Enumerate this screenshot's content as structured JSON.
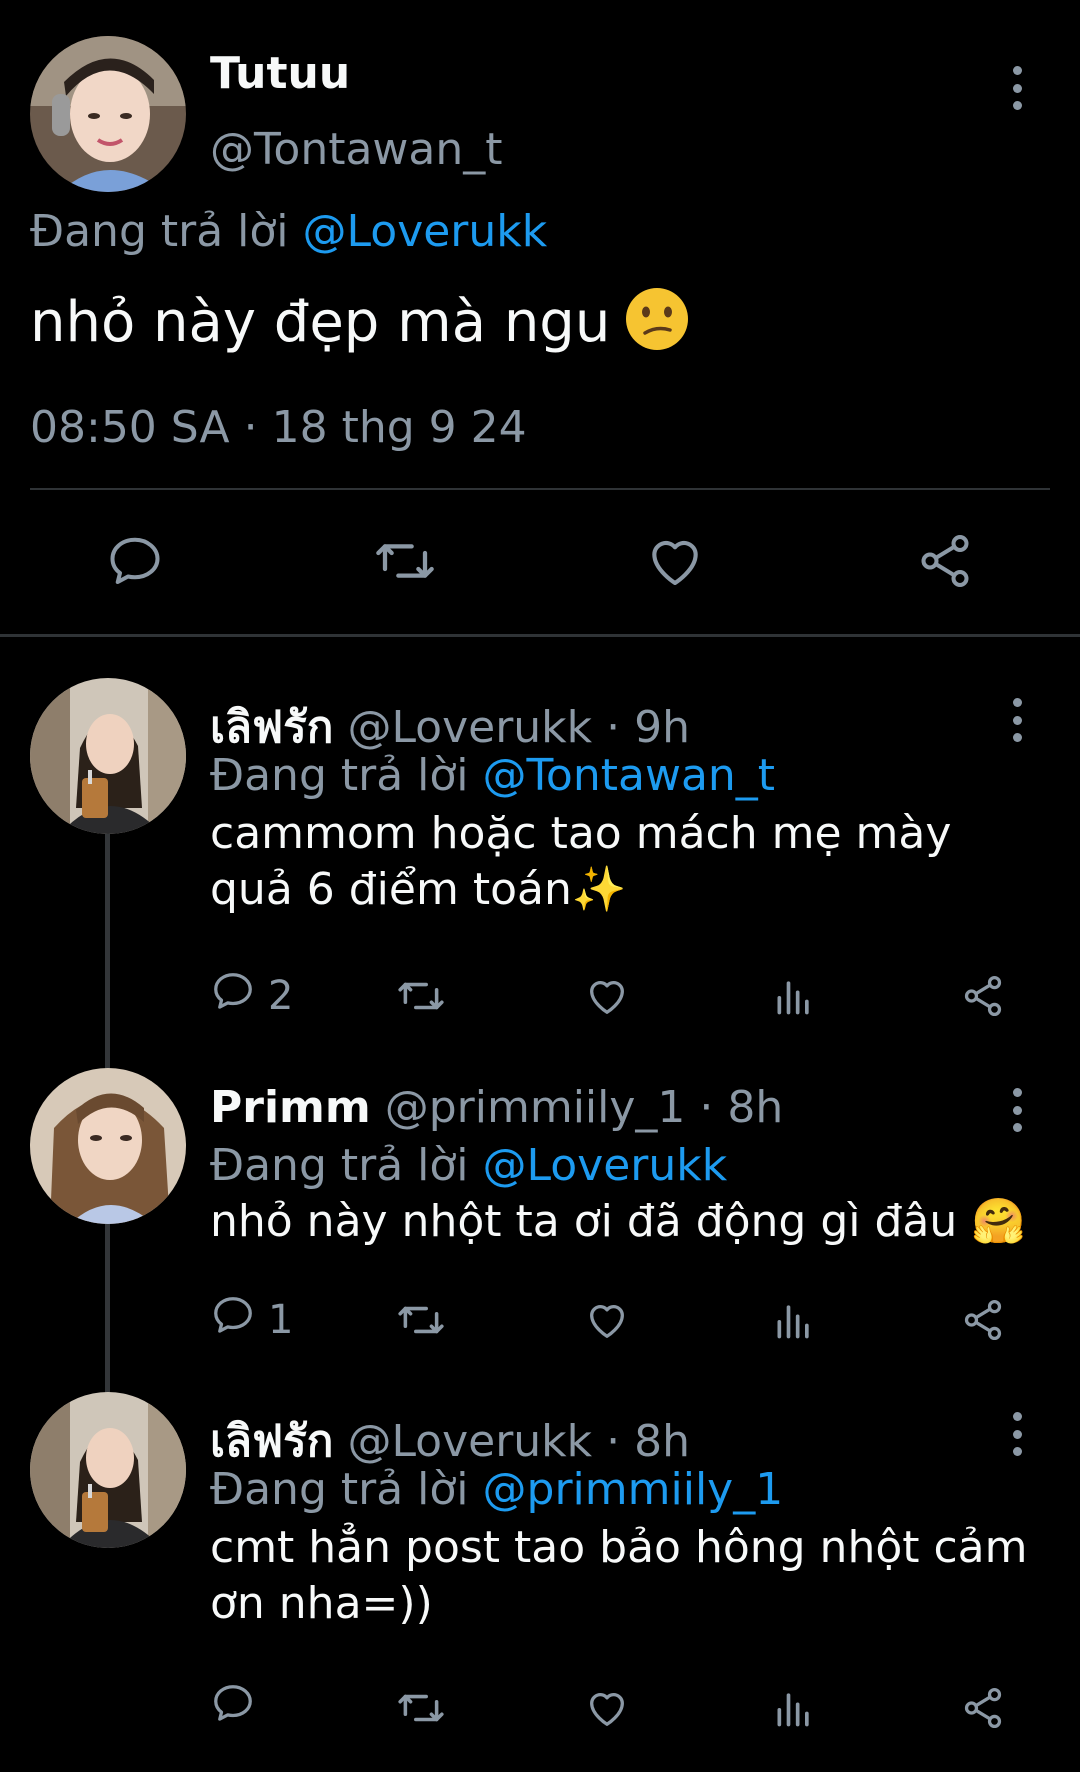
{
  "main_tweet": {
    "name": "Tutuu",
    "handle": "@Tontawan_t",
    "replying_prefix": "Đang trả lời",
    "replying_to": "@Loverukk",
    "text": "nhỏ này đẹp mà ngu",
    "emoji": "confused-face",
    "timestamp": "08:50 SA · 18 thg 9 24"
  },
  "replies": [
    {
      "name": "เลิฟรัก",
      "handle": "@Loverukk · 9h",
      "replying_prefix": "Đang trả lời",
      "replying_to": "@Tontawan_t",
      "text": "cammom hoặc tao mách mẹ mày quả 6 điểm toán✨",
      "reply_count": "2"
    },
    {
      "name": "Primm",
      "handle": "@primmiily_1 · 8h",
      "replying_prefix": "Đang trả lời",
      "replying_to": "@Loverukk",
      "text": "nhỏ này nhột ta ơi đã động gì đâu 🤗",
      "reply_count": "1"
    },
    {
      "name": "เลิฟรัก",
      "handle": "@Loverukk · 8h",
      "replying_prefix": "Đang trả lời",
      "replying_to": "@primmiily_1",
      "text": "cmt hẳn post tao bảo hông nhột cảm ơn nha=))",
      "reply_count": ""
    }
  ],
  "colors": {
    "background": "#000000",
    "text": "#f7f9f9",
    "secondary": "#8b98a5",
    "accent": "#1d9bf0",
    "divider": "#2f3336"
  },
  "icons": [
    "reply-icon",
    "retweet-icon",
    "like-icon",
    "share-icon",
    "views-icon",
    "more-icon"
  ]
}
